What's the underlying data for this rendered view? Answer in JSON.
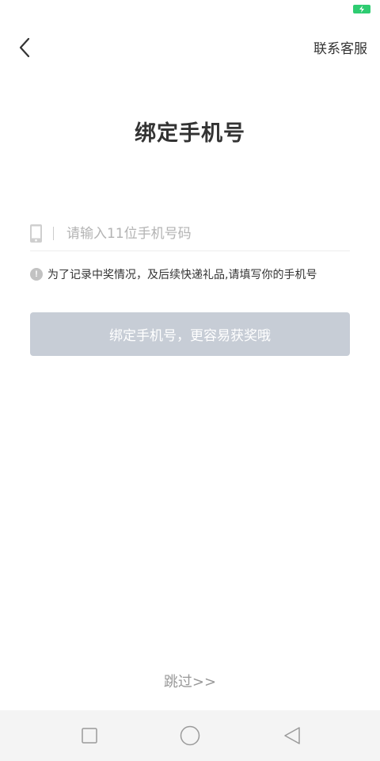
{
  "status_bar": {
    "battery_color": "#2ecc71",
    "battery_icon": "battery-charging-icon"
  },
  "header": {
    "back_icon": "chevron-left-icon",
    "service_label": "联系客服"
  },
  "main": {
    "title": "绑定手机号",
    "phone_field": {
      "icon": "phone-icon",
      "placeholder": "请输入11位手机号码",
      "value": ""
    },
    "notice": {
      "icon": "info-icon",
      "icon_glyph": "!",
      "text": "为了记录中奖情况，及后续快递礼品,请填写你的手机号"
    },
    "bind_button": {
      "label": "绑定手机号，更容易获奖哦",
      "color": "#c7cdd6"
    },
    "skip_label": "跳过>>"
  },
  "nav_bar": {
    "items": [
      "recent-apps-square-icon",
      "home-circle-icon",
      "back-triangle-icon"
    ]
  }
}
